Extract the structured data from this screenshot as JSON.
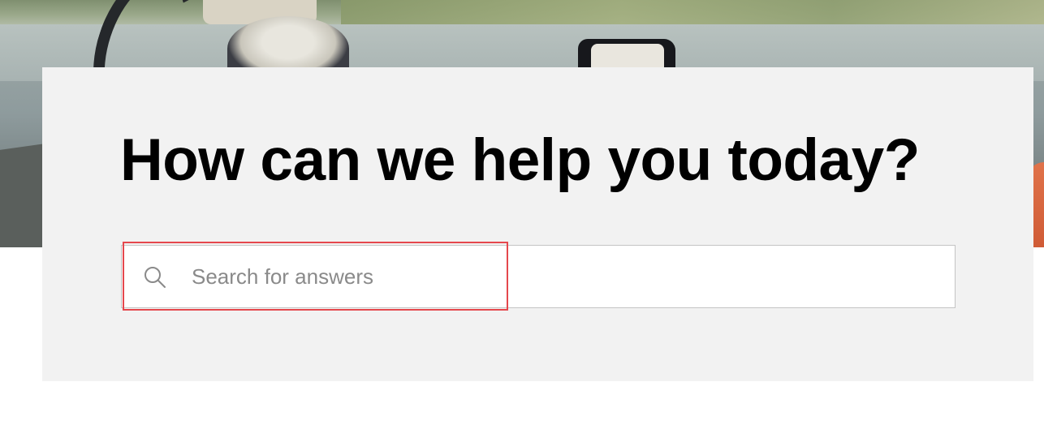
{
  "hero": {
    "image_icon": "photo-car-interior"
  },
  "help": {
    "title": "How can we help you today?",
    "search": {
      "placeholder": "Search for answers",
      "value": "",
      "icon": "search-icon"
    }
  },
  "colors": {
    "card_background": "#f2f2f2",
    "title_text": "#000000",
    "placeholder_text": "#8a8a8a",
    "highlight_border": "#e5484d"
  }
}
